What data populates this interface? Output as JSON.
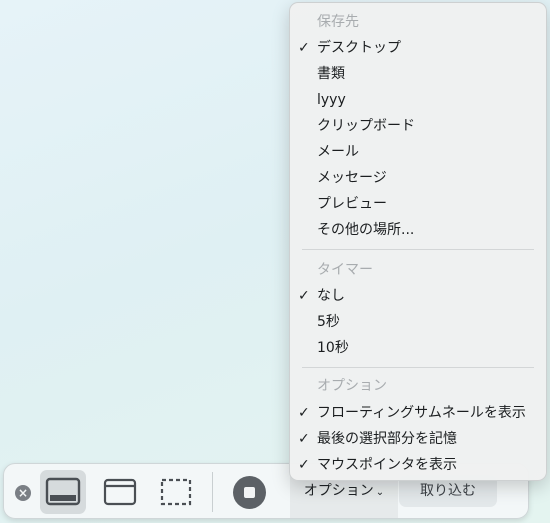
{
  "toolbar": {
    "close_icon": "close-circle-icon",
    "modes": [
      {
        "icon": "capture-screen-icon",
        "selected": true
      },
      {
        "icon": "capture-window-icon",
        "selected": false
      },
      {
        "icon": "capture-selection-icon",
        "selected": false
      }
    ],
    "record_icon": "record-stop-icon",
    "options_label": "オプション",
    "options_chevron": "⌄",
    "capture_label": "取り込む"
  },
  "menu": {
    "save_to": {
      "header": "保存先",
      "items": [
        {
          "label": "デスクトップ",
          "checked": true
        },
        {
          "label": "書類",
          "checked": false
        },
        {
          "label": "lyyy",
          "checked": false
        },
        {
          "label": "クリップボード",
          "checked": false
        },
        {
          "label": "メール",
          "checked": false
        },
        {
          "label": "メッセージ",
          "checked": false
        },
        {
          "label": "プレビュー",
          "checked": false
        },
        {
          "label": "その他の場所...",
          "checked": false
        }
      ]
    },
    "timer": {
      "header": "タイマー",
      "items": [
        {
          "label": "なし",
          "checked": true
        },
        {
          "label": "5秒",
          "checked": false
        },
        {
          "label": "10秒",
          "checked": false
        }
      ]
    },
    "options": {
      "header": "オプション",
      "items": [
        {
          "label": "フローティングサムネールを表示",
          "checked": true
        },
        {
          "label": "最後の選択部分を記憶",
          "checked": true
        },
        {
          "label": "マウスポインタを表示",
          "checked": true
        }
      ]
    },
    "check_glyph": "✓"
  }
}
